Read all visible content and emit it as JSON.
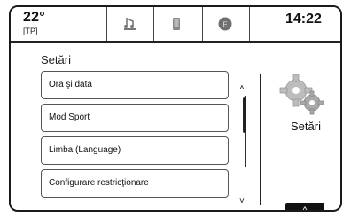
{
  "status": {
    "temperature": "22°",
    "tag": "[TP]",
    "time": "14:22"
  },
  "icons": [
    "music-icon",
    "phone-icon",
    "energy-icon"
  ],
  "page": {
    "title": "Setări"
  },
  "menu": {
    "items": [
      {
        "label": "Ora şi data"
      },
      {
        "label": "Mod Sport"
      },
      {
        "label": "Limba (Language)"
      },
      {
        "label": "Configurare restricţionare"
      }
    ]
  },
  "panel": {
    "label": "Setări"
  },
  "scroll": {
    "position_fraction": 0.12
  }
}
